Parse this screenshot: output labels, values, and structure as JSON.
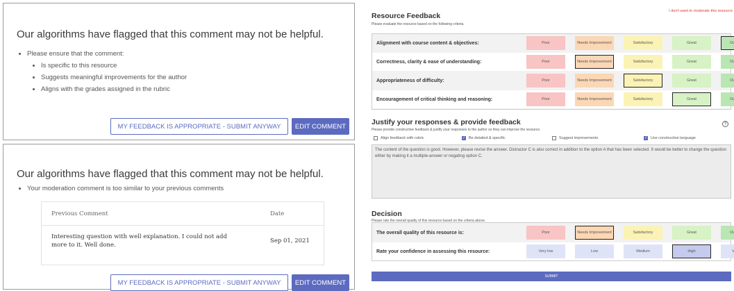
{
  "panel1": {
    "title": "Our algorithms have flagged that this comment may not be helpful.",
    "bullet": "Please ensure that the comment:",
    "sub_bullets": [
      "Is specific to this resource",
      "Suggests meaningful improvements for the author",
      "Aligns with the grades assigned in the rubric"
    ],
    "submit_anyway": "MY FEEDBACK IS APPROPRIATE - SUBMIT ANYWAY",
    "edit_comment": "EDIT COMMENT"
  },
  "panel2": {
    "title": "Our algorithms have flagged that this comment may not be helpful.",
    "bullet": "Your moderation comment is too similar to your previous comments",
    "table": {
      "col_comment": "Previous Comment",
      "col_date": "Date",
      "comment_line1": "Interesting question with well explanation. I could not add",
      "comment_line2": "more to it. Well done.",
      "date": "Sep 01, 2021"
    },
    "submit_anyway": "MY FEEDBACK IS APPROPRIATE - SUBMIT ANYWAY",
    "edit_comment": "EDIT COMMENT"
  },
  "feedback": {
    "title": "Resource Feedback",
    "subtitle": "Please evaluate the resource based on the following criteria.",
    "dont_moderate": "I don't want to moderate this resource",
    "scale": [
      "Poor",
      "Needs Improvement",
      "Satisfactory",
      "Great",
      "Outstanding"
    ],
    "rows": [
      {
        "label": "Alignment with course content & objectives:",
        "selected": 4
      },
      {
        "label": "Correctness, clarity & ease of understanding:",
        "selected": 1
      },
      {
        "label": "Appropriateness of difficulty:",
        "selected": 2
      },
      {
        "label": "Encouragement of critical thinking and reasoning:",
        "selected": 3
      }
    ],
    "colors": [
      "#f8c4c4",
      "#fbd7b5",
      "#fbf3b5",
      "#d7f2c4",
      "#b9e6b3"
    ]
  },
  "justify": {
    "title": "Justify your responses & provide feedback",
    "subtitle": "Please provide constructive feedback & justify your responses to the author so they can improve the resource.",
    "help": "?",
    "checks": [
      {
        "label": "Align feedback with rubric",
        "checked": false
      },
      {
        "label": "Be detailed & specific",
        "checked": true
      },
      {
        "label": "Suggest improvements",
        "checked": false
      },
      {
        "label": "Use constructive language",
        "checked": true
      }
    ],
    "text": "The content of the question is good. However, please revise the answer. Distractor C is also correct in addition to the option A that has been selected. It would be better to change the question either by making it a multiple-answer or negating option C."
  },
  "decision": {
    "title": "Decision",
    "subtitle": "Please rate the overall quality of this resource based on the criteria above.",
    "quality_label": "The overall quality of this resource is:",
    "quality_selected": 1,
    "confidence_label": "Rate your confidence in assessing this resource:",
    "confidence_scale": [
      "Very low",
      "Low",
      "Medium",
      "High",
      "Very High"
    ],
    "confidence_selected": 3,
    "confidence_color": "#dfe3f7",
    "confidence_selected_color": "#c5cbee",
    "submit": "SUBMIT"
  }
}
